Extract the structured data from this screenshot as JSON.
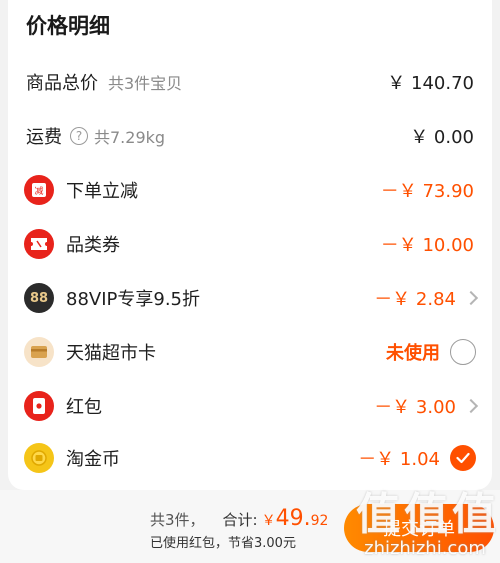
{
  "title": "价格明细",
  "rows": {
    "total": {
      "label": "商品总价",
      "sub": "共3件宝贝",
      "amount": "￥ 140.70"
    },
    "shipping": {
      "label": "运费",
      "help": "?",
      "sub": "共7.29kg",
      "amount": "￥ 0.00"
    }
  },
  "discounts": [
    {
      "icon": "instant-discount-icon",
      "label": "下单立减",
      "amount": "－￥ 73.90",
      "control": "none"
    },
    {
      "icon": "category-coupon-icon",
      "label": "品类券",
      "amount": "－￥ 10.00",
      "control": "none"
    },
    {
      "icon": "88vip-icon",
      "icon_text": "88",
      "label": "88VIP专享9.5折",
      "amount": "－￥ 2.84",
      "control": "chevron"
    },
    {
      "icon": "supermarket-card-icon",
      "label": "天猫超市卡",
      "amount": "未使用",
      "control": "radio-off"
    },
    {
      "icon": "red-packet-icon",
      "label": "红包",
      "amount": "－￥ 3.00",
      "control": "chevron"
    },
    {
      "icon": "taojinbi-coin-icon",
      "label": "淘金币",
      "amount": "－￥ 1.04",
      "control": "radio-on"
    }
  ],
  "footer": {
    "count": "共3件，",
    "total_label": "合计:",
    "currency": "￥",
    "total_int": "49.",
    "total_dec": "92",
    "note": "已使用红包，节省3.00元",
    "submit_label": "提交订单"
  },
  "watermark": {
    "glyphs": "值值值",
    "url": "zhizhizhi.com"
  },
  "colors": {
    "accent": "#ff5000",
    "red_icon": "#e8231b",
    "gold": "#f5c518"
  }
}
